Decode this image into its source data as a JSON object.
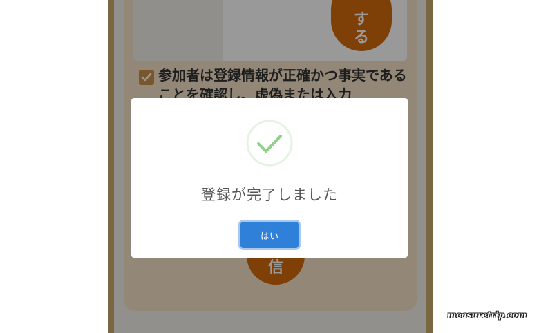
{
  "background_form": {
    "top_button_chars": [
      "す",
      "る"
    ],
    "consent_text": "参加者は登録情報が正確かつ事実であることを確認し、虚偽または入力",
    "submit_button_char": "信"
  },
  "modal": {
    "icon": "check-circle-icon",
    "title": "登録が完了しました",
    "confirm_label": "はい"
  },
  "watermark": "measuretrip.com",
  "colors": {
    "accent_orange": "#d36b0d",
    "primary_blue": "#2f80d8",
    "success_green": "#8fd18a",
    "frame_gold": "#c9ac6b"
  }
}
